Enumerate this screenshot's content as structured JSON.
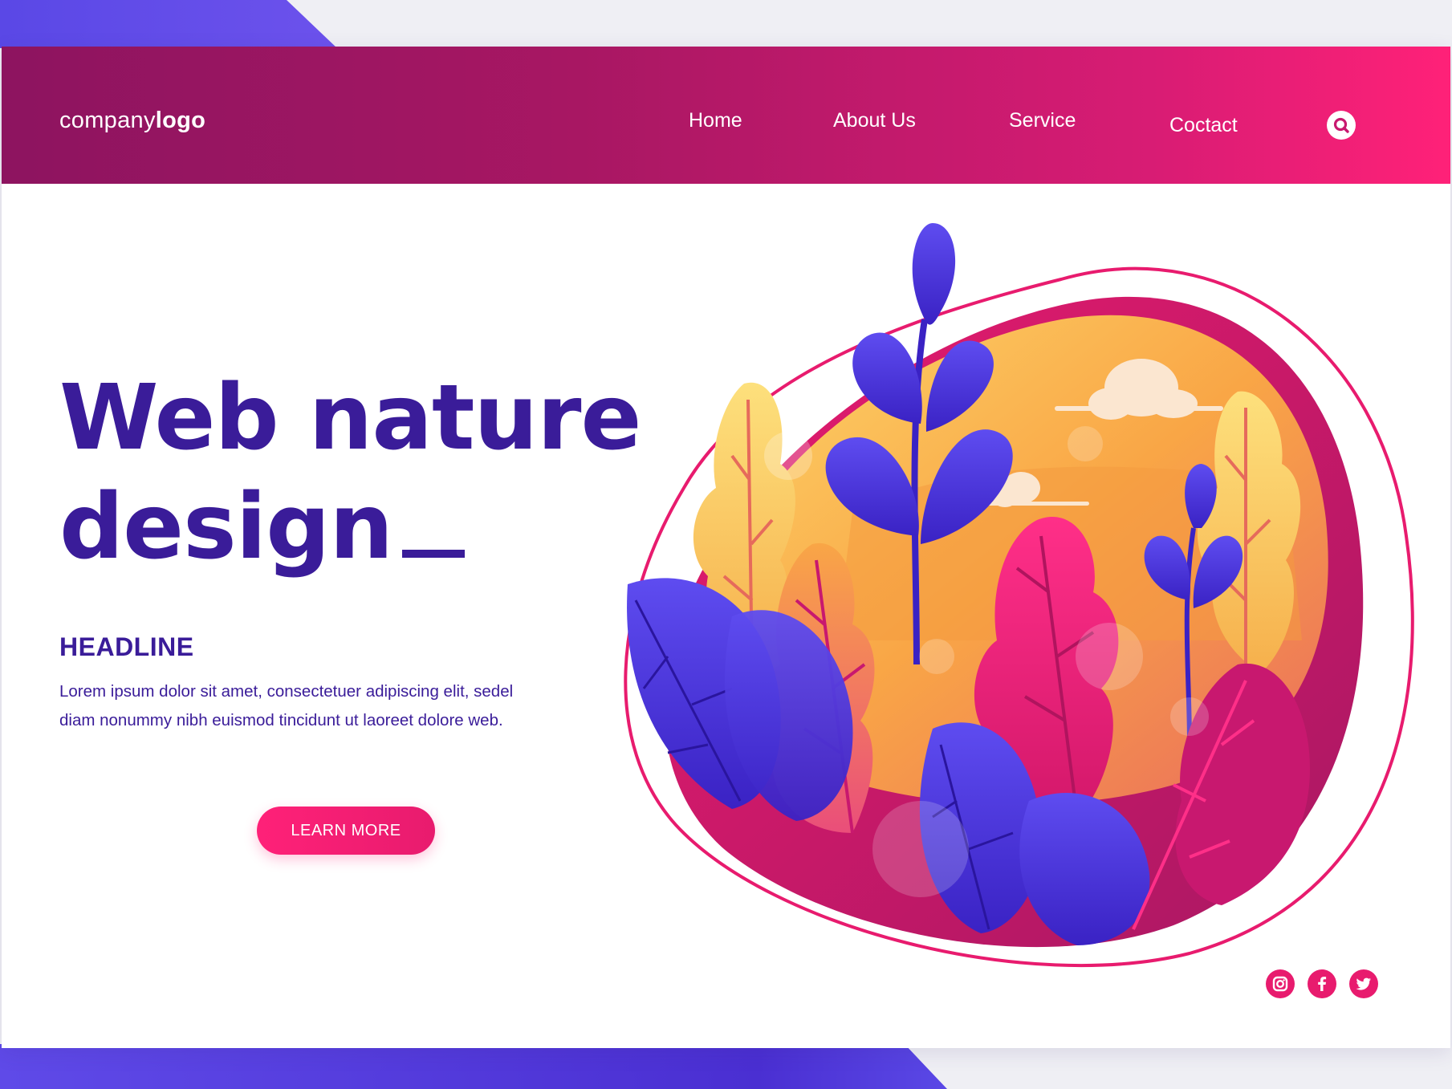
{
  "header": {
    "logo_regular": "company",
    "logo_bold": "logo",
    "nav": [
      "Home",
      "About Us",
      "Service",
      "Coctact"
    ],
    "search_icon": "search-icon"
  },
  "hero": {
    "title_line1": "Web nature",
    "title_line2": "design",
    "headline": "HEADLINE",
    "body_line1": "Lorem ipsum dolor sit amet, consectetuer adipiscing elit, sedel",
    "body_line2": "diam nonummy nibh euismod tincidunt ut laoreet dolore web.",
    "button_label": "LEARN MORE"
  },
  "social": [
    "instagram-icon",
    "facebook-icon",
    "twitter-icon"
  ],
  "colors": {
    "primary_text": "#3a1c99",
    "accent_pink": "#ff2178",
    "header_start": "#8d1460",
    "header_end": "#ff2178",
    "illustration_blue": "#4d3be0",
    "illustration_orange": "#f9a646",
    "illustration_yellow": "#fdd66a"
  }
}
